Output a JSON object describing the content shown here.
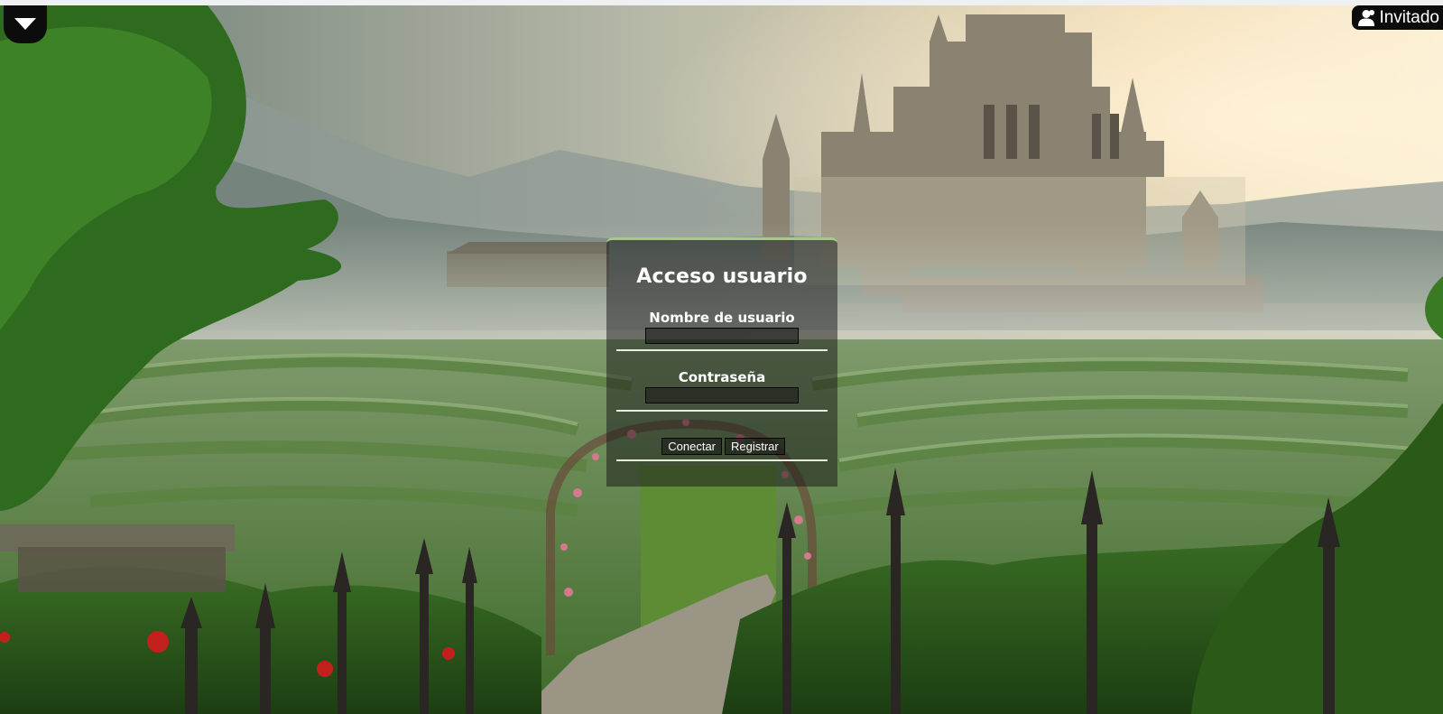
{
  "nav": {
    "menu_toggle_icon": "triangle-down-icon",
    "user_icon": "user-icon",
    "user_label": "Invitado"
  },
  "login": {
    "title": "Acceso usuario",
    "username_label": "Nombre de usuario",
    "username_value": "",
    "password_label": "Contraseña",
    "password_value": "",
    "connect_label": "Conectar",
    "register_label": "Registrar"
  },
  "colors": {
    "panel_accent": "#a6c98a",
    "bar_background": "#0c0c0c"
  }
}
